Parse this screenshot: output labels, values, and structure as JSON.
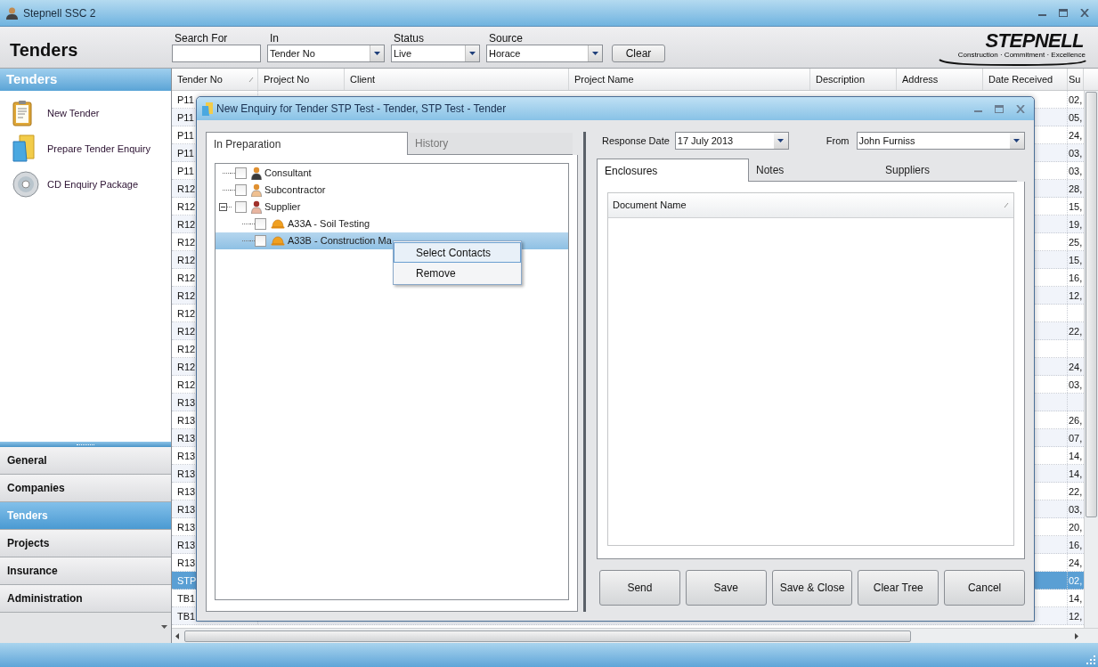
{
  "window": {
    "title": "Stepnell SSC 2"
  },
  "header": {
    "title": "Tenders"
  },
  "filters": [
    {
      "kind": "text",
      "label": "Search For"
    },
    {
      "kind": "select",
      "label": "In",
      "value": "Tender No"
    },
    {
      "kind": "select",
      "label": "Status",
      "value": "Live"
    },
    {
      "kind": "select",
      "label": "Source",
      "value": "Horace"
    }
  ],
  "clear_button": "Clear",
  "logo": {
    "name": "STEPNELL",
    "tagline": "Construction · Commitment · Excellence"
  },
  "sidebar": {
    "title": "Tenders",
    "actions": [
      {
        "kind": "clipboard",
        "label": "New Tender"
      },
      {
        "kind": "folder",
        "label": "Prepare Tender Enquiry"
      },
      {
        "kind": "disc",
        "label": "CD Enquiry Package"
      }
    ],
    "nav": [
      {
        "label": "General",
        "selected": false
      },
      {
        "label": "Companies",
        "selected": false
      },
      {
        "label": "Tenders",
        "selected": true
      },
      {
        "label": "Projects",
        "selected": false
      },
      {
        "label": "Insurance",
        "selected": false
      },
      {
        "label": "Administration",
        "selected": false
      }
    ]
  },
  "grid": {
    "columns": [
      "Tender No",
      "Project No",
      "Client",
      "Project Name",
      "Description",
      "Address",
      "Date Received",
      "Su"
    ],
    "rows": [
      {
        "tender_no": "P11",
        "column_8": "02,",
        "selected": false
      },
      {
        "tender_no": "P11",
        "column_8": "05,",
        "selected": false
      },
      {
        "tender_no": "P11",
        "column_8": "24,",
        "selected": false
      },
      {
        "tender_no": "P11",
        "column_8": "03,",
        "selected": false
      },
      {
        "tender_no": "P11",
        "column_8": "03,",
        "selected": false
      },
      {
        "tender_no": "R12",
        "column_8": "28,",
        "selected": false
      },
      {
        "tender_no": "R12",
        "column_8": "15,",
        "selected": false
      },
      {
        "tender_no": "R12",
        "column_8": "19,",
        "selected": false
      },
      {
        "tender_no": "R12",
        "column_8": "25,",
        "selected": false
      },
      {
        "tender_no": "R12",
        "column_8": "15,",
        "selected": false
      },
      {
        "tender_no": "R12",
        "column_8": "16,",
        "selected": false
      },
      {
        "tender_no": "R12",
        "column_8": "12,",
        "selected": false
      },
      {
        "tender_no": "R12",
        "selected": false
      },
      {
        "tender_no": "R12",
        "column_8": "22,",
        "selected": false
      },
      {
        "tender_no": "R12",
        "selected": false
      },
      {
        "tender_no": "R12",
        "column_8": "24,",
        "selected": false
      },
      {
        "tender_no": "R12",
        "column_8": "03,",
        "selected": false
      },
      {
        "tender_no": "R13",
        "selected": false
      },
      {
        "tender_no": "R13",
        "column_8": "26,",
        "selected": false
      },
      {
        "tender_no": "R13",
        "column_8": "07,",
        "selected": false
      },
      {
        "tender_no": "R13",
        "column_8": "14,",
        "selected": false
      },
      {
        "tender_no": "R13",
        "column_8": "14,",
        "selected": false
      },
      {
        "tender_no": "R13",
        "column_8": "22,",
        "selected": false
      },
      {
        "tender_no": "R13",
        "column_8": "03,",
        "selected": false
      },
      {
        "tender_no": "R13",
        "column_8": "20,",
        "selected": false
      },
      {
        "tender_no": "R13",
        "column_8": "16,",
        "selected": false
      },
      {
        "tender_no": "R13",
        "column_8": "24,",
        "selected": false
      },
      {
        "tender_no": "STP",
        "column_8": "02,",
        "selected": true
      },
      {
        "tender_no": "TB1",
        "column_8": "14,",
        "selected": false
      },
      {
        "tender_no": "TB1",
        "column_8": "12,",
        "selected": false
      }
    ]
  },
  "dialog": {
    "title": "New Enquiry for Tender STP Test - Tender, STP Test - Tender",
    "left_tabs": [
      {
        "label": "In Preparation",
        "selected": true
      },
      {
        "label": "History",
        "selected": false
      }
    ],
    "tree": [
      {
        "kind": "consultant",
        "label": "Consultant",
        "checked": false,
        "selected": false
      },
      {
        "kind": "subcontractor",
        "label": "Subcontractor",
        "checked": false,
        "selected": false
      },
      {
        "kind": "supplier",
        "label": "Supplier",
        "checked": false,
        "selected": false,
        "expanded": true,
        "children": [
          {
            "kind": "trade",
            "label": "A33A - Soil Testing",
            "checked": false,
            "selected": false
          },
          {
            "kind": "trade",
            "label": "A33B - Construction Ma",
            "checked": false,
            "selected": true
          }
        ]
      }
    ],
    "context_menu": [
      {
        "label": "Select Contacts",
        "selected": true
      },
      {
        "label": "Remove",
        "selected": false
      }
    ],
    "response_date": {
      "label": "Response Date",
      "value": "17 July 2013"
    },
    "from": {
      "label": "From",
      "value": "John Furniss"
    },
    "right_tabs": [
      {
        "label": "Enclosures",
        "selected": true
      },
      {
        "label": "Notes",
        "selected": false
      },
      {
        "label": "Suppliers",
        "selected": false
      }
    ],
    "enclosures_columns": [
      "Document Name"
    ],
    "buttons": [
      "Send",
      "Save",
      "Save & Close",
      "Clear Tree",
      "Cancel"
    ]
  }
}
